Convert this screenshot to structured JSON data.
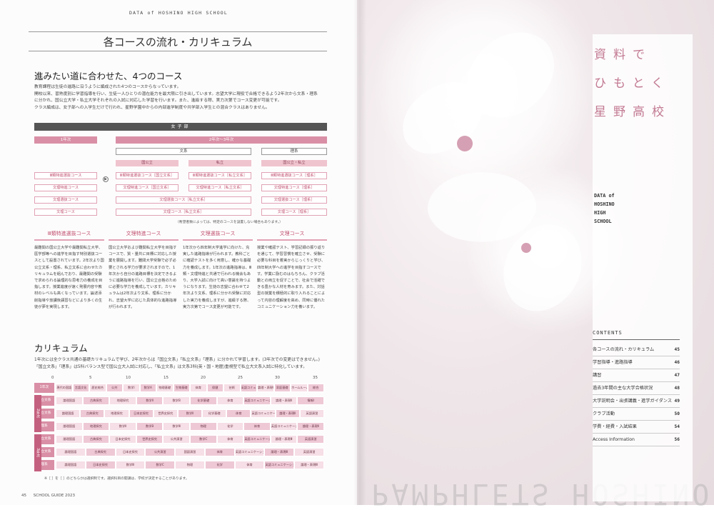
{
  "header_label": "DATA of HOSHINO HIGH SCHOOL",
  "page_title": "各コースの流れ・カリキュラム",
  "section1": {
    "title": "進みたい道に合わせた、4つのコース",
    "paragraphs": [
      "教育課程は生徒の進路に沿うように編成された4つのコースからなっています。",
      "開校以来、習熟度別に学習指導を行い、生徒一人ひとりの潜在能力を最大限に引き出しています。志望大学に現役で合格できるよう2年次から文系・理系",
      "に分かれ、国公立大学・私立大学それぞれの入試に対応した学習を行います。また、進級する際、実力次第でコース変更が可能です。",
      "クラス編成は、女子部への入学生だけで行われ、星野学園中からの内部進学制度や共学部入学生との混合クラスはありません。"
    ]
  },
  "flow": {
    "band": "女子部",
    "year1": "1年次",
    "year23": "2年次〜3年次",
    "bunkei": "文系",
    "rikei": "理系",
    "kokkoritsu": "国公立",
    "shiritsu": "私立",
    "kokushi": "国公立・私立",
    "y1_courses": [
      "Ⅲ類特進選抜コース",
      "文理特進コース",
      "文理選抜コース",
      "文理コース"
    ],
    "arrow": "▶",
    "col_koku": [
      "Ⅲ類特進選抜コース［国立文系］",
      "文理特進コース［国立文系］"
    ],
    "col_shi": [
      "Ⅲ類特進選抜コース［私立文系］",
      "文理特進コース［私立文系］"
    ],
    "col_wide": [
      "文理選抜コース［私立文系］",
      "文理コース［私立文系］"
    ],
    "col_ri": [
      "Ⅲ類特進選抜コース［理系］",
      "文理特進コース［理系］",
      "文理選抜コース［理系］",
      "文理コース［理系］"
    ],
    "footnote": "（希望者数によっては、特定のコースを設置しない場合もあります。）"
  },
  "courses": [
    {
      "name": "Ⅲ類特進選抜コース",
      "text": "最難関の国公立大学や最難関私立大学、医学部等への進学を目指す特別選抜コースとして設置されています。2年次より国公立文系・理系、私立文系に合わせたカリキュラムを組んでおり、最難関の受験で求められる論理的な思考力の養成を目指します。授業進度が速く発展内容や教材のレベルも高くなっています。論述添削指導や放課後講習などにより多くの生徒が夢を実現します。"
    },
    {
      "name": "文理特進コース",
      "text": "国公立大学および難関私立大学を目指すコースで、質・量共に目標に対応した授業を展開します。難関大学受験で必ず必要とされる学力が要求されますので、1年次から自分の進路目標を決定できるように進路指導を行い、国公立合格のために必要な学力を養成しています。カリキュラムは2年次より文系、理系に分かれ、志望大学に応じた具体的な進路指導が行われます。"
    },
    {
      "name": "文理選抜コース",
      "text": "1年次から四年制大学進学に向けた、充実した進路指導が行われます。教科ごとに確認テストを多く用意し、確かな基礎力を養成します。1年次の進路指導は、Ⅲ類・文理特進と共通で行われる機会もあり、大学入試に向けて高い意識を持つようになります。生徒の志望に合わせて2年次より文系、理系に分かれ受験に対応した実力を養成しますが、進級する際、実力次第でコース変更が可能です。"
    },
    {
      "name": "文理コース",
      "text": "授業や確認テスト、学習記録の振り返りを通じて、学習習慣を確立させ、受験に必要な科目を着実からじっくりと学び、四年制大学への進学を目指すコースです。学業に励むのはもちろん、クラブ活動との両立を促すことで、社会で活躍できる豊かな人材を育みます。また、対話型の授業を積極的に取り入れることによって内容の理解度を高め、同時に優れたコミュニケーション力を養います。"
    }
  ],
  "section2": {
    "title": "カリキュラム",
    "paragraphs": [
      "1年次には全クラス共通の基礎カリキュラムで学び、2年次からは「国立文系」「私立文系」「理系」に分かれて学習します。(3年次での変更はできません。)",
      "「国立文系」「理系」は5科バランス型で国公立大入試に対応し、「私立文系」は文系3科(英・国・地歴)重視型で私立大文系入試に特化しています。"
    ]
  },
  "chart_data": {
    "type": "table",
    "scale_ticks": [
      "0",
      "5",
      "10",
      "15",
      "20",
      "25",
      "30",
      "35"
    ],
    "side_labels": [
      "2年次",
      "3年次"
    ],
    "rows": [
      {
        "label": "1年次",
        "cells": [
          "現代の国語",
          "言語文化",
          "歴史総合",
          "公共",
          "数学Ⅰ",
          "数学A",
          "物理基礎",
          "生物基礎",
          "体育",
          "保健",
          "芸術",
          "英語コミュニケーションⅠ",
          "論理・表現Ⅰ",
          "家庭基礎",
          "ホームルーム",
          "総合"
        ]
      },
      {
        "label": "国立文系",
        "cells": [
          "論理国語",
          "古典探究",
          "地理探究",
          "数学Ⅱ",
          "数学B",
          "化学基礎",
          "体育",
          "英語コミュニケーションⅡ",
          "論理・表現Ⅱ",
          "情報Ⅰ"
        ]
      },
      {
        "label": "私立文系",
        "cells": [
          "論理国語",
          "古典探究",
          "地理探究",
          "日本史探究",
          "世界史探究",
          "数学Ⅱ",
          "化学基礎",
          "体育",
          "英語コミュニケーションⅡ",
          "論理・表現Ⅱ",
          "英語演習"
        ]
      },
      {
        "label": "理系",
        "cells": [
          "論理国語",
          "地理探究",
          "数学Ⅱ",
          "数学B",
          "数学Ⅲ",
          "物理",
          "化学",
          "体育",
          "英語コミュニケーションⅡ",
          "論理・表現Ⅱ"
        ]
      },
      {
        "label": "国立文系",
        "cells": [
          "論理国語",
          "古典探究",
          "日本史探究",
          "世界史探究",
          "公共演習",
          "数学C",
          "体育",
          "英語コミュニケーションⅢ",
          "論理・表現Ⅲ",
          "英語演習"
        ]
      },
      {
        "label": "私立文系",
        "cells": [
          "論理国語",
          "古典探究",
          "日本史探究",
          "公共演習",
          "国語演習",
          "体育",
          "英語コミュニケーションⅢ",
          "論理・表現Ⅲ",
          "英語演習"
        ]
      },
      {
        "label": "理系",
        "cells": [
          "論理国語",
          "日本史探究",
          "数学Ⅲ",
          "数学C",
          "物理",
          "化学",
          "体育",
          "英語コミュニケーションⅢ",
          "論理・表現Ⅲ"
        ]
      }
    ],
    "table_note": "※［ ］を［ ］のどちらかは選択制です。選択科目の開講は、学校が決定することがあります。"
  },
  "footer": {
    "page": "45",
    "guide": "SCHOOL GUIDE 2023"
  },
  "right": {
    "vtitle_lines": [
      "資料で",
      "ひもとく",
      "星野高校"
    ],
    "data_of_lines": [
      "DATA of",
      "HOSHINO",
      "HIGH",
      "SCHOOL"
    ],
    "contents_heading": "CONTENTS",
    "toc": [
      {
        "title": "各コースの流れ・カリキュラム",
        "page": "45"
      },
      {
        "title": "学習指導・進路指導",
        "page": "46"
      },
      {
        "title": "講習",
        "page": "47"
      },
      {
        "title": "過去3年間の主な大学合格状況",
        "page": "48"
      },
      {
        "title": "大学説明会・出張講義・進学ガイダンス",
        "page": "49"
      },
      {
        "title": "クラブ活動",
        "page": "50"
      },
      {
        "title": "学費・経費・入試結果",
        "page": "54"
      },
      {
        "title": "Access Information",
        "page": "56"
      }
    ],
    "bigword": "PAMPHLETS HOSHINO"
  },
  "colors": {
    "accent": "#d98fa6",
    "accent_dark": "#c0506f",
    "band": "#555555"
  }
}
